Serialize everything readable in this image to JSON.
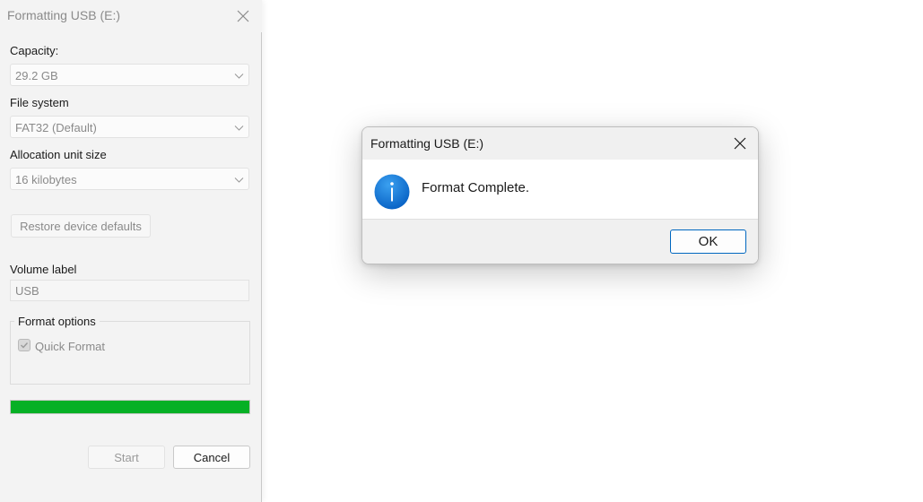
{
  "format_window": {
    "title": "Formatting USB (E:)",
    "capacity": {
      "label": "Capacity:",
      "value": "29.2 GB"
    },
    "file_system": {
      "label": "File system",
      "value": "FAT32 (Default)"
    },
    "allocation_unit": {
      "label": "Allocation unit size",
      "value": "16 kilobytes"
    },
    "restore_defaults_label": "Restore device defaults",
    "volume_label": {
      "label": "Volume label",
      "value": "USB"
    },
    "format_options": {
      "legend": "Format options",
      "quick_format_label": "Quick Format",
      "quick_format_checked": true
    },
    "progress_percent": 100,
    "progress_color": "#06b025",
    "start_label": "Start",
    "cancel_label": "Cancel"
  },
  "dialog": {
    "title": "Formatting USB (E:)",
    "icon": "info-icon",
    "message": "Format Complete.",
    "ok_label": "OK"
  },
  "colors": {
    "accent": "#0067c0",
    "info_icon": "#0a74d6"
  }
}
